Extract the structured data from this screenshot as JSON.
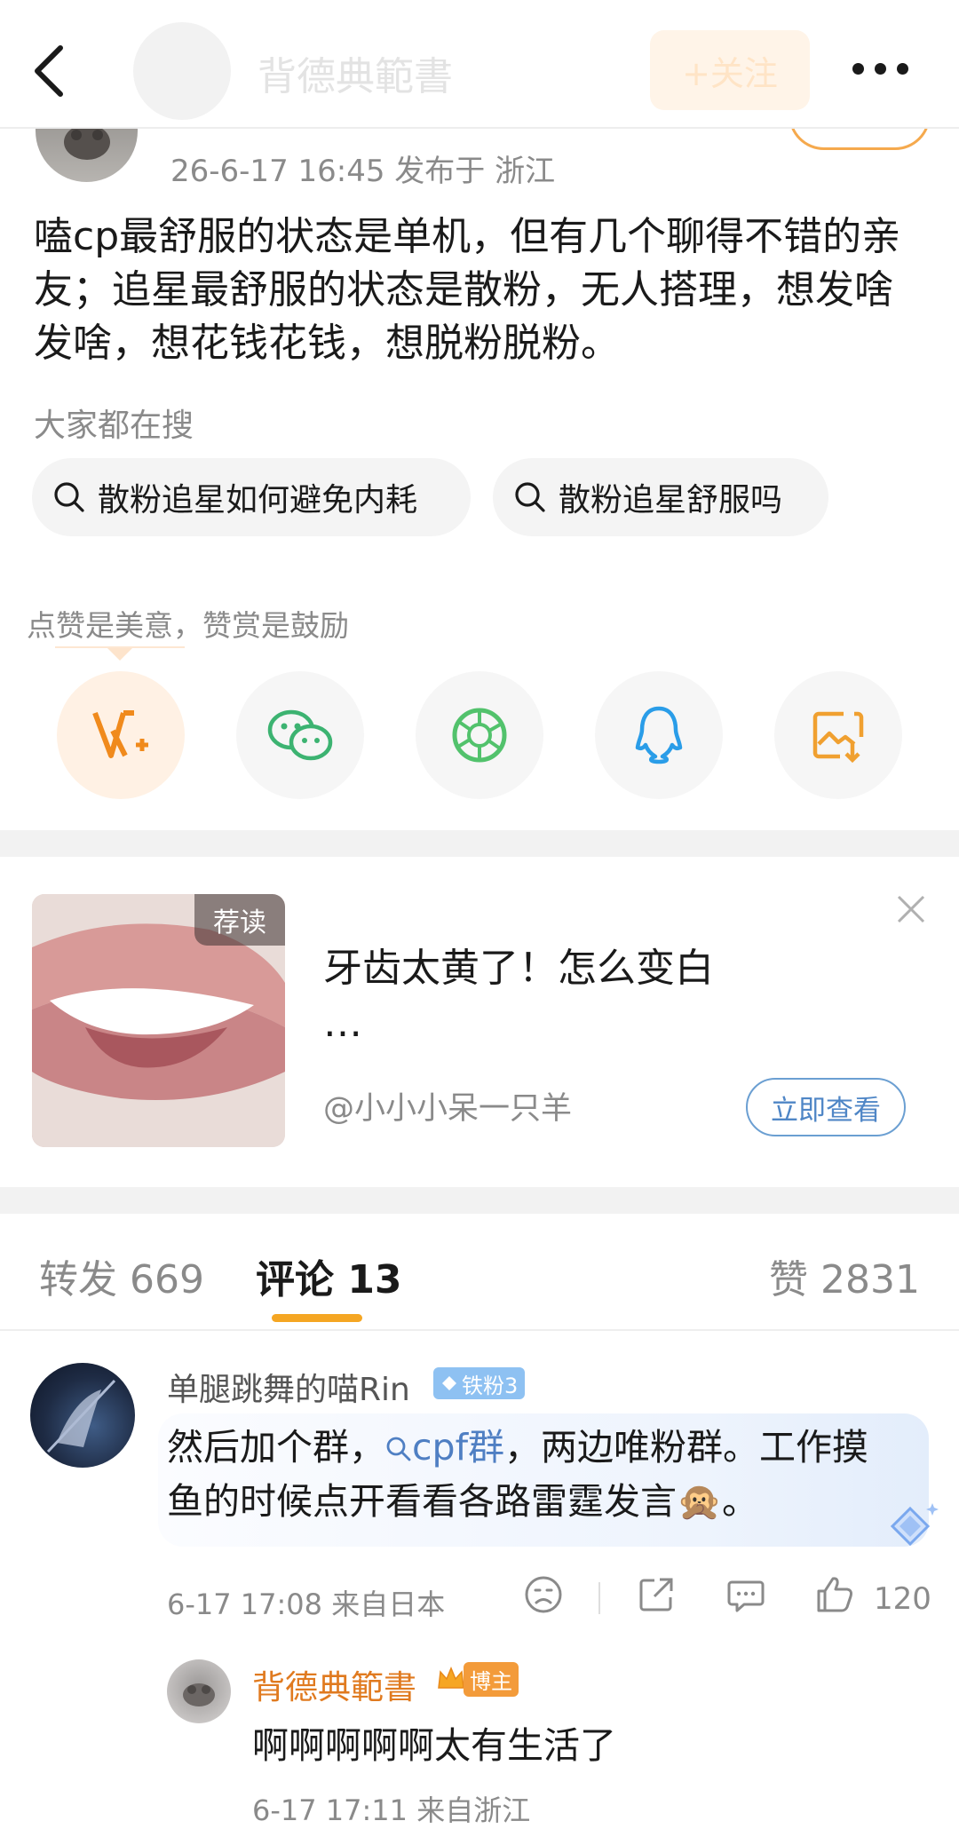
{
  "topbar": {
    "name": "背德典範書",
    "follow_label": "+关注"
  },
  "post": {
    "meta": "26-6-17 16:45  发布于 浙江",
    "body": "嗑cp最舒服的状态是单机，但有几个聊得不错的亲友；追星最舒服的状态是散粉，无人搭理，想发啥发啥，想花钱花钱，想脱粉脱粉。",
    "hot_label": "大家都在搜",
    "search_chips": [
      "散粉追星如何避免内耗",
      "散粉追星舒服吗"
    ]
  },
  "reward": {
    "tip": "点赞是美意，赞赏是鼓励"
  },
  "share_icons": [
    "v-plus-icon",
    "wechat-icon",
    "moments-icon",
    "qq-icon",
    "save-image-icon"
  ],
  "recommend": {
    "badge": "荐读",
    "title": "牙齿太黄了！怎么变白\n…",
    "author": "@小小小呆一只羊",
    "button": "立即查看"
  },
  "tabs": {
    "repost": "转发 669",
    "comments": "评论 13",
    "likes": "赞 2831"
  },
  "comment": {
    "user": "单腿跳舞的喵Rin",
    "fan_badge": "铁粉3",
    "text_before": "然后加个群，",
    "hashtag": "cpf群",
    "text_after": "，两边唯粉群。工作摸鱼的时候点开看看各路雷霆发言🙊。",
    "meta": "6-17 17:08  来自日本",
    "like_count": "120"
  },
  "reply": {
    "user": "背德典範書",
    "badge": "博主",
    "text": "啊啊啊啊啊太有生活了",
    "meta": "6-17 17:11  来自浙江"
  },
  "colors": {
    "accent_orange": "#f5a623",
    "link_blue": "#4f7fc3"
  }
}
